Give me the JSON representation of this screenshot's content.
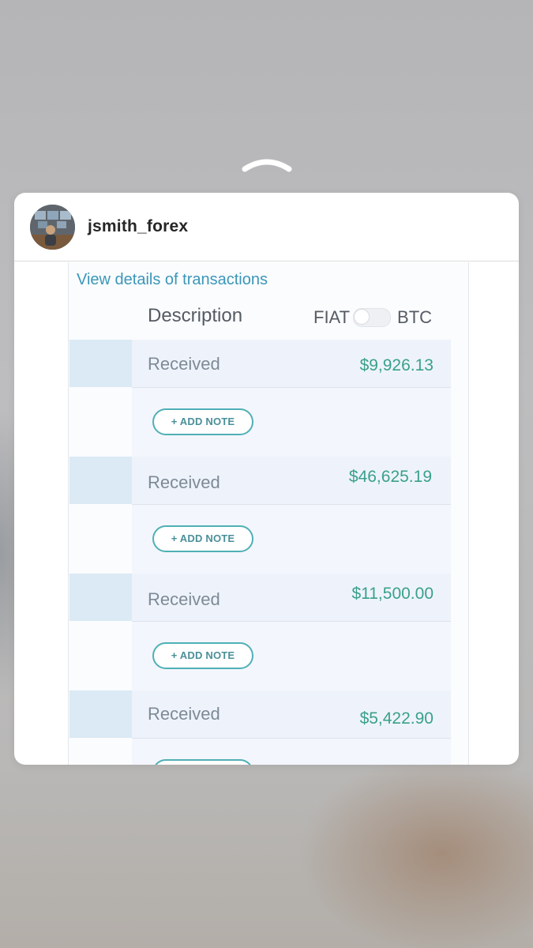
{
  "profile": {
    "username": "jsmith_forex"
  },
  "post": {
    "details_link": "View details of transactions",
    "column_header": "Description",
    "toggle": {
      "left_label": "FIAT",
      "right_label": "BTC",
      "selected": "FIAT"
    },
    "add_note_label": "+ ADD NOTE",
    "transactions": [
      {
        "description": "Received",
        "amount": "$9,926.13"
      },
      {
        "description": "Received",
        "amount": "$46,625.19"
      },
      {
        "description": "Received",
        "amount": "$11,500.00"
      },
      {
        "description": "Received",
        "amount": "$5,422.90"
      }
    ]
  },
  "colors": {
    "link": "#3b96b9",
    "amount": "#3aa08a",
    "button_border": "#4fb0b6",
    "row_background": "#eef3fb",
    "thumb_background": "#dbeaf4"
  }
}
